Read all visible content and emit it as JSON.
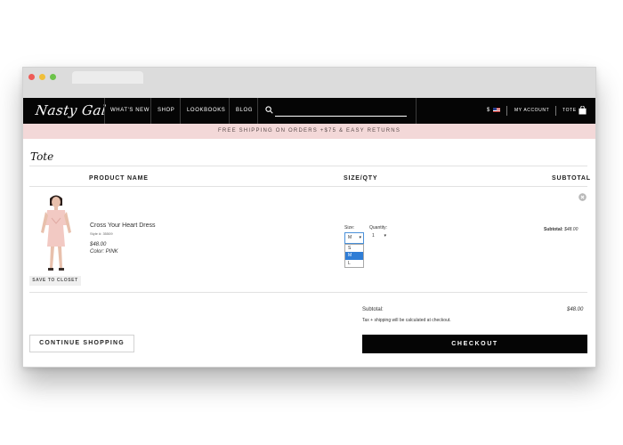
{
  "nav": {
    "logo": "Nasty Gal",
    "links": [
      "WHAT'S NEW",
      "SHOP",
      "LOOKBOOKS",
      "BLOG"
    ],
    "currency": "$",
    "my_account": "MY ACCOUNT",
    "tote": "TOTE"
  },
  "promo": {
    "text": "FREE SHIPPING ON ORDERS +$75 & EASY RETURNS"
  },
  "page": {
    "title": "Tote"
  },
  "table": {
    "headers": {
      "product": "PRODUCT NAME",
      "size_qty": "SIZE/QTY",
      "subtotal": "SUBTOTAL"
    }
  },
  "item": {
    "name": "Cross Your Heart Dress",
    "style": "Style #: 35509",
    "price": "$48.00",
    "color": "Color: PINK",
    "save_to_closet": "SAVE TO CLOSET",
    "size_label": "Size:",
    "size_selected": "M",
    "size_options": [
      "S",
      "M",
      "L"
    ],
    "qty_label": "Quantity:",
    "qty_value": "1",
    "subtotal_label": "Subtotal:",
    "subtotal_value": "$48.00"
  },
  "summary": {
    "label": "Subtotal:",
    "value": "$48.00",
    "note": "Tax + shipping will be calculated at checkout."
  },
  "actions": {
    "continue": "CONTINUE SHOPPING",
    "checkout": "CHECKOUT"
  },
  "colors": {
    "nav_bg": "#050505",
    "promo_bg": "#f3d8d8",
    "select_highlight": "#2f7dd6"
  },
  "icons": [
    "search-icon",
    "flag-icon",
    "bag-icon",
    "remove-icon"
  ]
}
